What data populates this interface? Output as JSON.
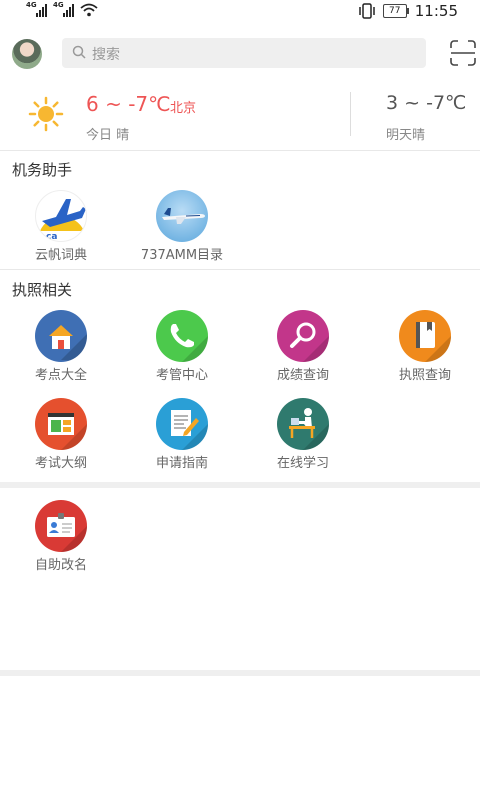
{
  "statusbar": {
    "net1": "4G",
    "net2": "4G",
    "battery": "77",
    "time": "11:55"
  },
  "search": {
    "placeholder": "搜索"
  },
  "weather": {
    "today_temp": "6 ~ -7℃",
    "city": "北京",
    "today_label": "今日 晴",
    "tomorrow_temp": "3 ~ -7℃",
    "tomorrow_label": "明天晴"
  },
  "sections": {
    "assistant": {
      "title": "机务助手",
      "items": [
        {
          "label": "云帆词典",
          "icon": "yunfan-plane-icon"
        },
        {
          "label": "737AMM目录",
          "icon": "airliner-icon"
        }
      ]
    },
    "license": {
      "title": "执照相关",
      "items": [
        {
          "label": "考点大全",
          "icon": "house-icon",
          "color": "#3f6fb4"
        },
        {
          "label": "考管中心",
          "icon": "phone-icon",
          "color": "#4cc94c"
        },
        {
          "label": "成绩查询",
          "icon": "magnifier-icon",
          "color": "#c2368a"
        },
        {
          "label": "执照查询",
          "icon": "book-icon",
          "color": "#f08a1c"
        },
        {
          "label": "考试大纲",
          "icon": "webpage-icon",
          "color": "#e5502e"
        },
        {
          "label": "申请指南",
          "icon": "notepad-icon",
          "color": "#2a9fd6"
        },
        {
          "label": "在线学习",
          "icon": "student-desk-icon",
          "color": "#2f7a6e"
        }
      ]
    },
    "extra": {
      "items": [
        {
          "label": "自助改名",
          "icon": "id-card-icon",
          "color": "#d93a35"
        }
      ]
    }
  }
}
